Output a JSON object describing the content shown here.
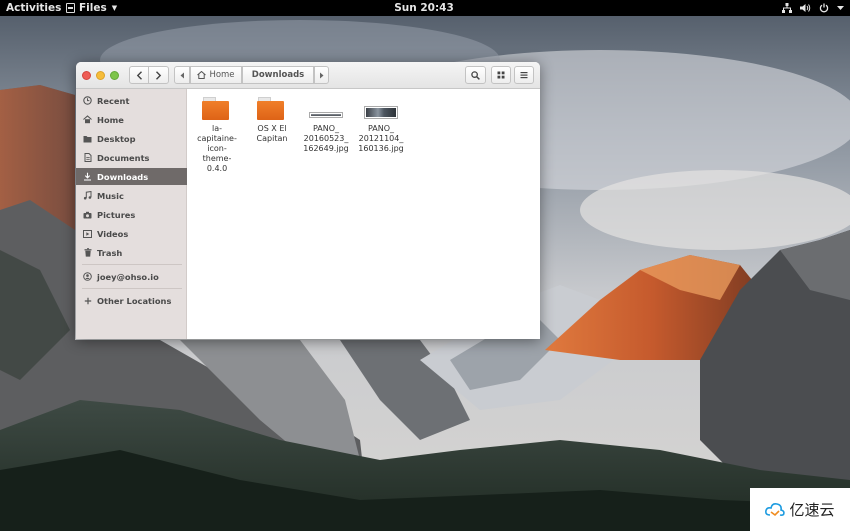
{
  "topbar": {
    "activities": "Activities",
    "app_menu": "Files",
    "clock": "Sun 20:43",
    "icons": [
      "network-icon",
      "volume-icon",
      "power-icon"
    ]
  },
  "window": {
    "pathbar": {
      "home_label": "Home",
      "current_label": "Downloads"
    },
    "sidebar": {
      "items": [
        {
          "label": "Recent",
          "icon": "clock-icon"
        },
        {
          "label": "Home",
          "icon": "home-icon"
        },
        {
          "label": "Desktop",
          "icon": "desktop-folder-icon"
        },
        {
          "label": "Documents",
          "icon": "document-icon"
        },
        {
          "label": "Downloads",
          "icon": "download-icon",
          "selected": true
        },
        {
          "label": "Music",
          "icon": "music-icon"
        },
        {
          "label": "Pictures",
          "icon": "camera-icon"
        },
        {
          "label": "Videos",
          "icon": "video-icon"
        },
        {
          "label": "Trash",
          "icon": "trash-icon"
        }
      ],
      "account": {
        "label": "joey@ohso.io",
        "icon": "user-icon"
      },
      "other_locations": {
        "label": "Other Locations",
        "icon": "plus-icon"
      }
    },
    "files": [
      {
        "name_lines": [
          "la-",
          "capitaine-",
          "icon-",
          "theme-",
          "0.4.0"
        ],
        "type": "folder"
      },
      {
        "name_lines": [
          "OS X El",
          "Capitan"
        ],
        "type": "folder"
      },
      {
        "name_lines": [
          "PANO_",
          "20160523_",
          "162649.jpg"
        ],
        "type": "image"
      },
      {
        "name_lines": [
          "PANO_",
          "20121104_",
          "160136.jpg"
        ],
        "type": "image"
      }
    ]
  },
  "watermark": {
    "text": "亿速云"
  },
  "colors": {
    "accent_selected": "#6f6a69",
    "folder": "#e8701f",
    "topbar": "#000000"
  }
}
